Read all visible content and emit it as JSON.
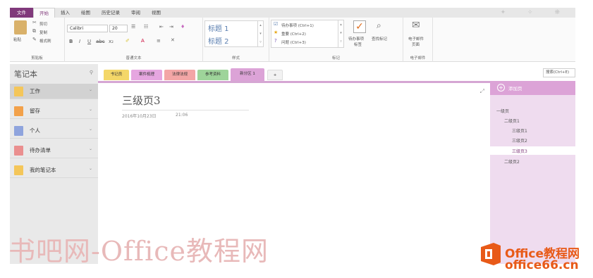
{
  "ribbon": {
    "tabs": [
      "文件",
      "开始",
      "插入",
      "绘图",
      "历史记录",
      "审阅",
      "视图"
    ],
    "active_tab": "开始",
    "clipboard": {
      "paste": "粘贴",
      "cut": "剪切",
      "copy": "复制",
      "format_painter": "格式刷",
      "group_label": "剪贴板"
    },
    "text": {
      "font": "Calibri",
      "size": "20",
      "group_label": "普通文本"
    },
    "styles": {
      "items": [
        "标题 1",
        "标题 2"
      ],
      "group_label": "样式"
    },
    "tags": {
      "items": [
        {
          "label": "待办事项 (Ctrl+1)",
          "icon": "checkbox-icon"
        },
        {
          "label": "重要 (Ctrl+2)",
          "icon": "star-icon"
        },
        {
          "label": "问题 (Ctrl+3)",
          "icon": "question-icon"
        }
      ],
      "todo_tag_line1": "待办事项",
      "todo_tag_line2": "标签",
      "find_tags": "查找标记",
      "group_label": "标记"
    },
    "email": {
      "line1": "电子邮件",
      "line2": "页面",
      "group_label": "电子邮件"
    }
  },
  "notebooks": {
    "header": "笔记本",
    "items": [
      {
        "label": "工作",
        "color": "#f4c65a"
      },
      {
        "label": "留存",
        "color": "#f2a14a"
      },
      {
        "label": "个人",
        "color": "#8fa4dd"
      },
      {
        "label": "待办清单",
        "color": "#ea8f8f"
      },
      {
        "label": "我的笔记本",
        "color": "#f4c65a"
      }
    ]
  },
  "sections": {
    "items": [
      {
        "label": "书记员",
        "color": "#f4d768"
      },
      {
        "label": "案件梳理",
        "color": "#e6a6e0"
      },
      {
        "label": "法律法规",
        "color": "#f3a6a6"
      },
      {
        "label": "参考资料",
        "color": "#9ed49a"
      },
      {
        "label": "新分区 1",
        "color": "#dca3d7"
      }
    ],
    "add": "+",
    "search_placeholder": "搜索(Ctrl+E)"
  },
  "page": {
    "title": "三级页3",
    "date": "2016年10月23日",
    "time": "21:06"
  },
  "pages": {
    "add_label": "添加页",
    "items": [
      {
        "label": "一级页",
        "level": 1
      },
      {
        "label": "二级页1",
        "level": 2
      },
      {
        "label": "三级页1",
        "level": 3
      },
      {
        "label": "三级页2",
        "level": 3
      },
      {
        "label": "三级页3",
        "level": 3
      },
      {
        "label": "二级页2",
        "level": 2
      }
    ],
    "selected": "三级页3"
  },
  "watermark": {
    "left": "书吧网-Office教程网",
    "logo_top": "Office教程网",
    "logo_bottom": "office66.cn"
  },
  "colors": {
    "accent": "#80397b",
    "page_bg": "#efdcef",
    "add_page": "#dca3d7"
  }
}
